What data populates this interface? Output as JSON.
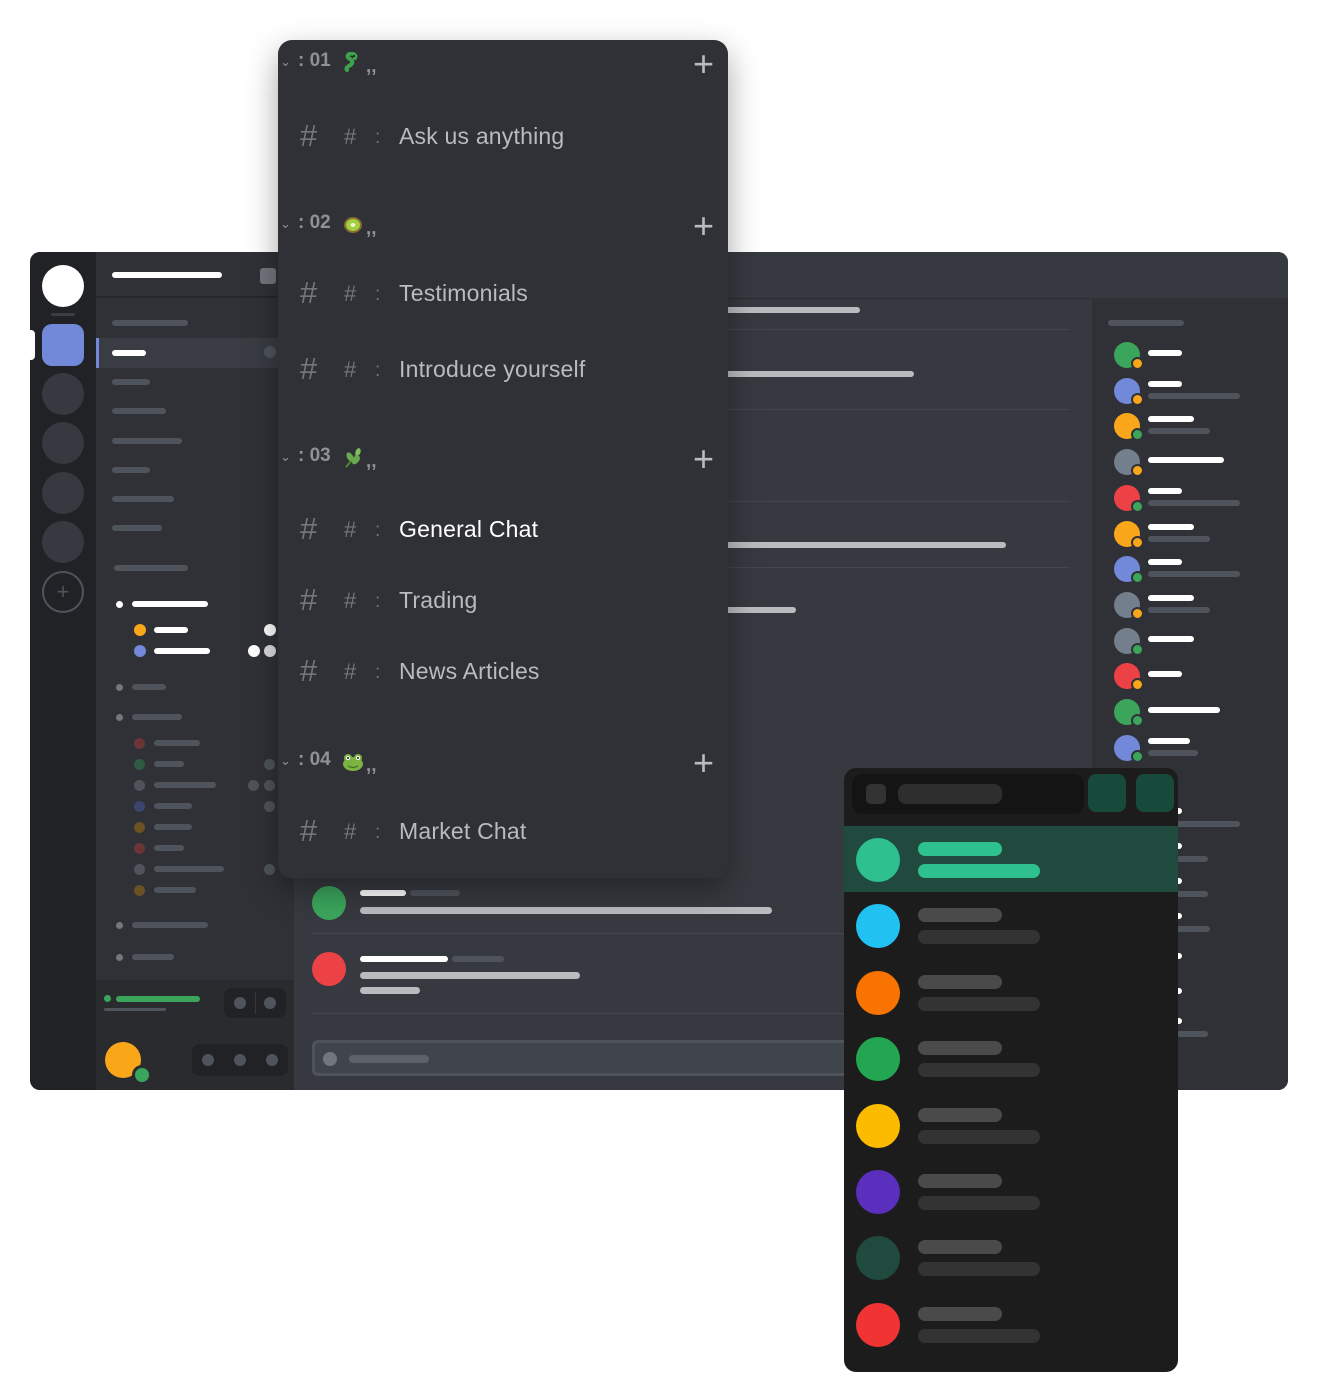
{
  "category_menu": {
    "categories": [
      {
        "number": ": 01",
        "emoji": "snake-emoji",
        "suffix": ",,",
        "plus": "+"
      },
      {
        "number": ": 02",
        "emoji": "kiwi-emoji",
        "suffix": ",,",
        "plus": "+"
      },
      {
        "number": ": 03",
        "emoji": "herb-emoji",
        "suffix": ",,",
        "plus": "+"
      },
      {
        "number": ": 04",
        "emoji": "frog-emoji",
        "suffix": ",,",
        "plus": "+"
      }
    ],
    "channels": [
      {
        "name": "Ask us anything",
        "category": 0
      },
      {
        "name": "Testimonials",
        "category": 1
      },
      {
        "name": "Introduce yourself",
        "category": 1
      },
      {
        "name": "General Chat",
        "category": 2,
        "active": true
      },
      {
        "name": "Trading",
        "category": 2
      },
      {
        "name": "News Articles",
        "category": 2
      },
      {
        "name": "Market Chat",
        "category": 3
      }
    ],
    "hash_big": "#",
    "hash_small": "#",
    "separator": ":"
  },
  "color_picker": {
    "swatches": [
      "#2ec08e",
      "#21c2f2",
      "#f97300",
      "#22a652",
      "#fdbb00",
      "#5b2fbe",
      "#1f4a3d",
      "#f03434"
    ],
    "selected_index": 0
  },
  "colors": {
    "blurple": "#7289da",
    "green": "#3ba55c",
    "red": "#ed4245",
    "orange": "#faa61a",
    "grey": "#747f8d"
  }
}
